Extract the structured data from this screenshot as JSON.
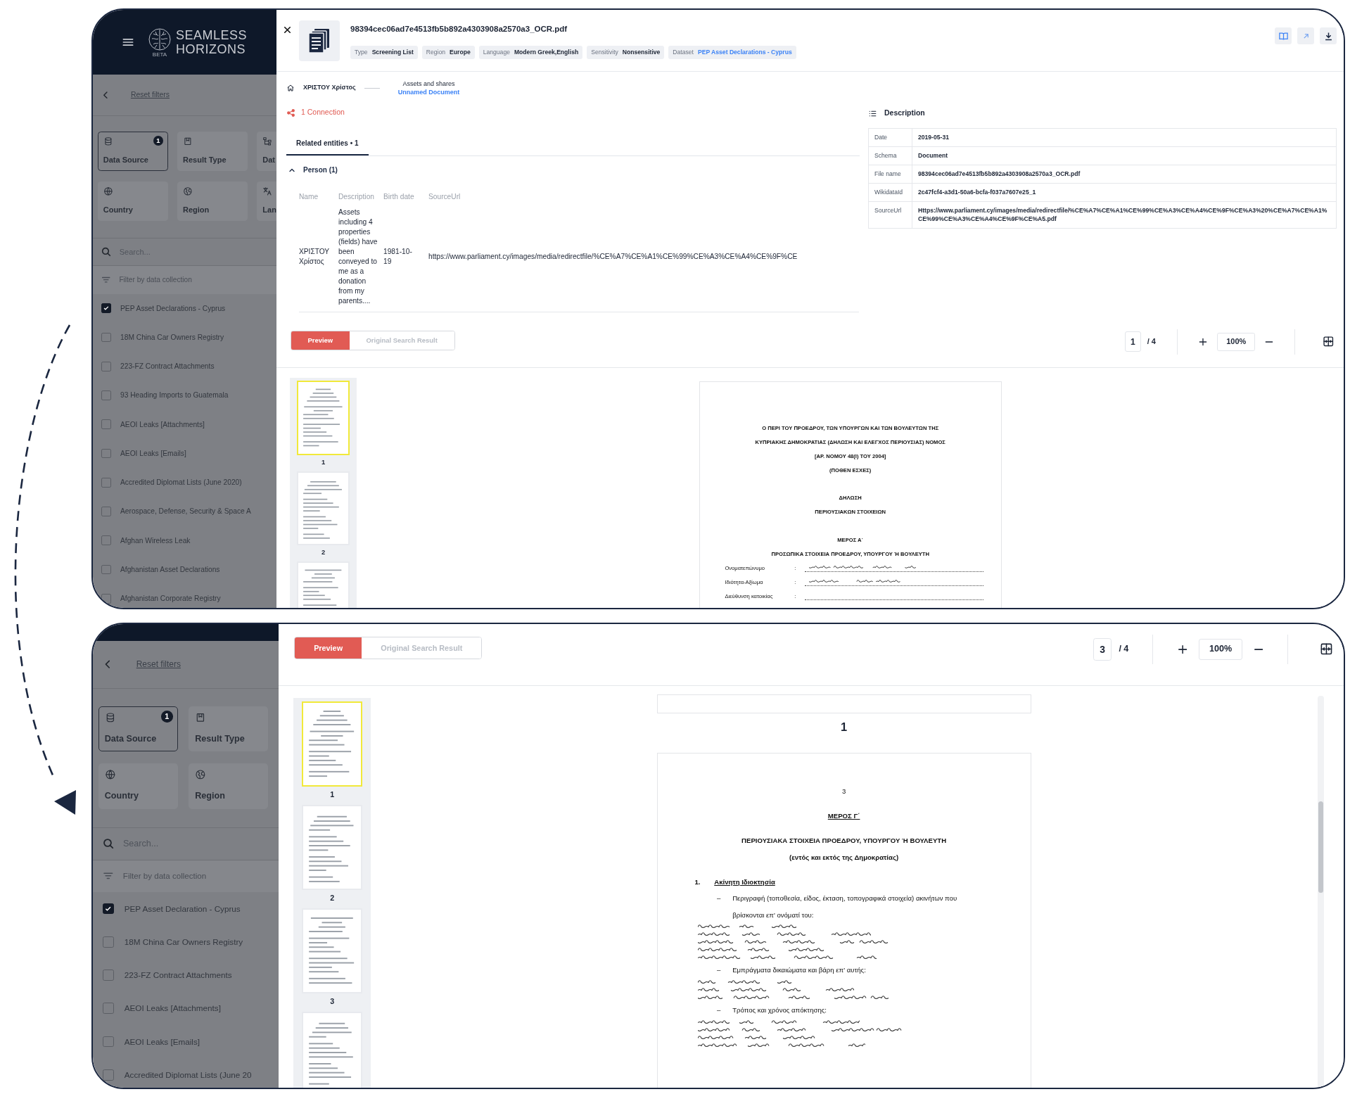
{
  "top_view": {
    "sidebar": {
      "logo": {
        "name_line_1": "SEAMLESS",
        "name_line_2": "HORIZONS",
        "badge": "BETA"
      },
      "reset_filters": "Reset filters",
      "filter_tiles": [
        {
          "kind": "source",
          "label": "Data Source",
          "selected": true,
          "count": "1"
        },
        {
          "kind": "result_type",
          "label": "Result Type",
          "selected": false
        },
        {
          "kind": "dataset",
          "label": "Dat",
          "selected": false
        },
        {
          "kind": "country",
          "label": "Country",
          "selected": false
        },
        {
          "kind": "region",
          "label": "Region",
          "selected": false
        },
        {
          "kind": "language",
          "label": "Lan",
          "selected": false
        }
      ],
      "search": {
        "placeholder": "Search..."
      },
      "collection_filter": "Filter by data collection",
      "collections": [
        {
          "label": "PEP Asset Declarations - Cyprus",
          "checked": true
        },
        {
          "label": "18M China Car Owners Registry",
          "checked": false
        },
        {
          "label": "223-FZ Contract Attachments",
          "checked": false
        },
        {
          "label": "93 Heading Imports to Guatemala",
          "checked": false
        },
        {
          "label": "AEOI Leaks [Attachments]",
          "checked": false
        },
        {
          "label": "AEOI Leaks [Emails]",
          "checked": false
        },
        {
          "label": "Accredited Diplomat Lists (June 2020)",
          "checked": false
        },
        {
          "label": "Aerospace, Defense, Security & Space A",
          "checked": false
        },
        {
          "label": "Afghan Wireless Leak",
          "checked": false
        },
        {
          "label": "Afghanistan Asset Declarations",
          "checked": false
        },
        {
          "label": "Afghanistan Corporate Registry",
          "checked": false
        }
      ]
    },
    "document": {
      "file_name": "98394cec06ad7e4513fb5b892a4303908a2570a3_OCR.pdf",
      "tags": [
        {
          "label": "Type",
          "value": "Screening List",
          "link": false
        },
        {
          "label": "Region",
          "value": "Europe",
          "link": false
        },
        {
          "label": "Language",
          "value": "Modern Greek,English",
          "link": false
        },
        {
          "label": "Sensitivity",
          "value": "Nonsensitive",
          "link": false
        },
        {
          "label": "Dataset",
          "value": "PEP Asset Declarations - Cyprus",
          "link": true
        }
      ],
      "breadcrumb": {
        "entity": "ΧΡΙΣΤΟΥ Χρίστος",
        "section": "Assets and shares",
        "document": "Unnamed Document"
      },
      "connections": "1 Connection",
      "tabs": [
        {
          "label": "Related entities • 1",
          "selected": true
        }
      ],
      "entity_group": {
        "title": "Person (1)",
        "expanded": true,
        "columns": [
          "Name",
          "Description",
          "Birth date",
          "SourceUrl"
        ],
        "rows": [
          [
            "ΧΡΙΣΤΟΥ Χρίστος",
            "Assets including 4 properties (fields) have been conveyed to me as a donation from my parents....",
            "1981-10-19",
            "https://www.parliament.cy/images/media/redirectfile/%CE%A7%CE%A1%CE%99%CE%A3%CE%A4%CE%9F%CE"
          ]
        ]
      },
      "description": {
        "title": "Description",
        "rows": [
          {
            "key": "Date",
            "value": "2019-05-31"
          },
          {
            "key": "Schema",
            "value": "Document"
          },
          {
            "key": "File name",
            "value": "98394cec06ad7e4513fb5b892a4303908a2570a3_OCR.pdf"
          },
          {
            "key": "WikidataId",
            "value": "2c47fcf4-a3d1-50a6-bcfa-f037a7607e25_1"
          },
          {
            "key": "SourceUrl",
            "value": "Https://www.parliament.cy/images/media/redirectfile/%CE%A7%CE%A1%CE%99%CE%A3%CE%A4%CE%9F%CE%A3%20%CE%A7%CE%A1%CE%99%CE%A3%CE%A4%CE%9F%CE%A5.pdf"
          }
        ]
      }
    },
    "viewer": {
      "modes": [
        {
          "label": "Preview",
          "selected": true
        },
        {
          "label": "Original Search Result",
          "selected": false
        }
      ],
      "page": "1",
      "page_total": "/ 4",
      "zoom": "100%",
      "thumbnails": [
        {
          "label": "1",
          "selected": true
        },
        {
          "label": "2",
          "selected": false
        },
        {
          "selected": false
        }
      ],
      "pages": [
        {
          "blocks": [
            [
              {
                "kind": "heading",
                "text": "Ο ΠΕΡΙ ΤΟΥ ΠΡΟΕΔΡΟΥ, ΤΩΝ ΥΠΟΥΡΓΩΝ ΚΑΙ ΤΩΝ ΒΟΥΛΕΥΤΩΝ ΤΗΣ"
              },
              {
                "kind": "heading",
                "text": "ΚΥΠΡΙΑΚΗΣ ΔΗΜΟΚΡΑΤΙΑΣ (ΔΗΛΩΣΗ ΚΑΙ ΕΛΕΓΧΟΣ ΠΕΡΙΟΥΣΙΑΣ) ΝΟΜΟΣ"
              },
              {
                "kind": "heading",
                "text": "[ΑΡ. ΝΟΜΟΥ 48(Ι) ΤΟΥ 2004]"
              },
              {
                "kind": "heading",
                "text": "(ΠΟΘΕΝ ΕΣΧΕΣ)"
              }
            ],
            [
              {
                "kind": "heading",
                "text": "ΔΗΛΩΣΗ"
              },
              {
                "kind": "heading",
                "text": "ΠΕΡΙΟΥΣΙΑΚΩΝ ΣΤΟΙΧΕΙΩΝ"
              }
            ],
            [
              {
                "kind": "heading",
                "text": "ΜΕΡΟΣ Α΄"
              },
              {
                "kind": "heading",
                "text": "ΠΡΟΣΩΠΙΚΑ ΣΤΟΙΧΕΙΑ ΠΡΟΕΔΡΟΥ, ΥΠΟΥΡΓΟΥ Ή ΒΟΥΛΕΥΤΗ"
              },
              {
                "kind": "field",
                "label": "Ονοματεπώνυμο",
                "colon": ":",
                "filled": true
              },
              {
                "kind": "field",
                "label": "Ιδιότητα-Αξίωμα",
                "colon": ":",
                "filled": true
              },
              {
                "kind": "field",
                "label": "Διεύθυνση κατοικίας",
                "colon": ":",
                "filled": false
              }
            ]
          ]
        }
      ]
    }
  },
  "bottom_view": {
    "sidebar": {
      "reset_filters": "Reset filters",
      "filter_tiles": [
        {
          "kind": "source",
          "label": "Data Source",
          "selected": true,
          "count": "1"
        },
        {
          "kind": "result_type",
          "label": "Result Type",
          "selected": false
        },
        {
          "kind": "country",
          "label": "Country",
          "selected": false
        },
        {
          "kind": "region",
          "label": "Region",
          "selected": false
        }
      ],
      "search": {
        "placeholder": "Search..."
      },
      "collection_filter": "Filter by data collection",
      "collections": [
        {
          "label": "PEP Asset Declaration - Cyprus",
          "checked": true
        },
        {
          "label": "18M China Car Owners Registry",
          "checked": false
        },
        {
          "label": "223-FZ Contract Attachments",
          "checked": false
        },
        {
          "label": "AEOI Leaks [Attachments]",
          "checked": false
        },
        {
          "label": "AEOI Leaks [Emails]",
          "checked": false
        },
        {
          "label": "Accredited Diplomat Lists (June 20",
          "checked": false
        }
      ]
    },
    "viewer": {
      "modes": [
        {
          "label": "Preview",
          "selected": true
        },
        {
          "label": "Original Search Result",
          "selected": false
        }
      ],
      "page": "3",
      "page_total": "/ 4",
      "zoom": "100%",
      "thumbnails": [
        {
          "label": "1",
          "selected": true
        },
        {
          "label": "2",
          "selected": false
        },
        {
          "label": "3",
          "selected": false
        },
        {
          "selected": false
        }
      ],
      "pages": [
        {
          "label": "1"
        },
        {
          "blocks": [
            [
              {
                "kind": "number",
                "text": "3"
              }
            ],
            [
              {
                "kind": "underlined",
                "text": "ΜΕΡΟΣ Γ΄"
              }
            ],
            [
              {
                "kind": "heading",
                "text": "ΠΕΡΙΟΥΣΙΑΚΑ ΣΤΟΙΧΕΙΑ ΠΡΟΕΔΡΟΥ, ΥΠΟΥΡΓΟΥ Ή ΒΟΥΛΕΥΤΗ"
              },
              {
                "kind": "subheading",
                "text": "(εντός και εκτός της Δημοκρατίας)"
              }
            ],
            [
              {
                "kind": "section",
                "number": "1.",
                "text": "Ακίνητη Ιδιοκτησία"
              },
              {
                "kind": "item",
                "dash": "–",
                "text": "Περιγραφή (τοποθεσία, είδος, έκταση, τοπογραφικά στοιχεία) ακινήτων που"
              },
              {
                "kind": "text",
                "text": "βρίσκονται επ' ονόματί του:"
              },
              {
                "kind": "handwriting"
              },
              {
                "kind": "handwriting"
              },
              {
                "kind": "handwriting"
              },
              {
                "kind": "handwriting"
              },
              {
                "kind": "handwriting"
              },
              {
                "kind": "item",
                "dash": "–",
                "text": "Εμπράγματα δικαιώματα και βάρη επ' αυτής:"
              },
              {
                "kind": "handwriting"
              },
              {
                "kind": "handwriting"
              },
              {
                "kind": "handwriting"
              },
              {
                "kind": "item",
                "dash": "–",
                "text": "Τρόπος και χρόνος απόκτησης:"
              },
              {
                "kind": "handwriting"
              },
              {
                "kind": "handwriting"
              },
              {
                "kind": "handwriting"
              },
              {
                "kind": "handwriting"
              }
            ]
          ]
        }
      ]
    }
  }
}
